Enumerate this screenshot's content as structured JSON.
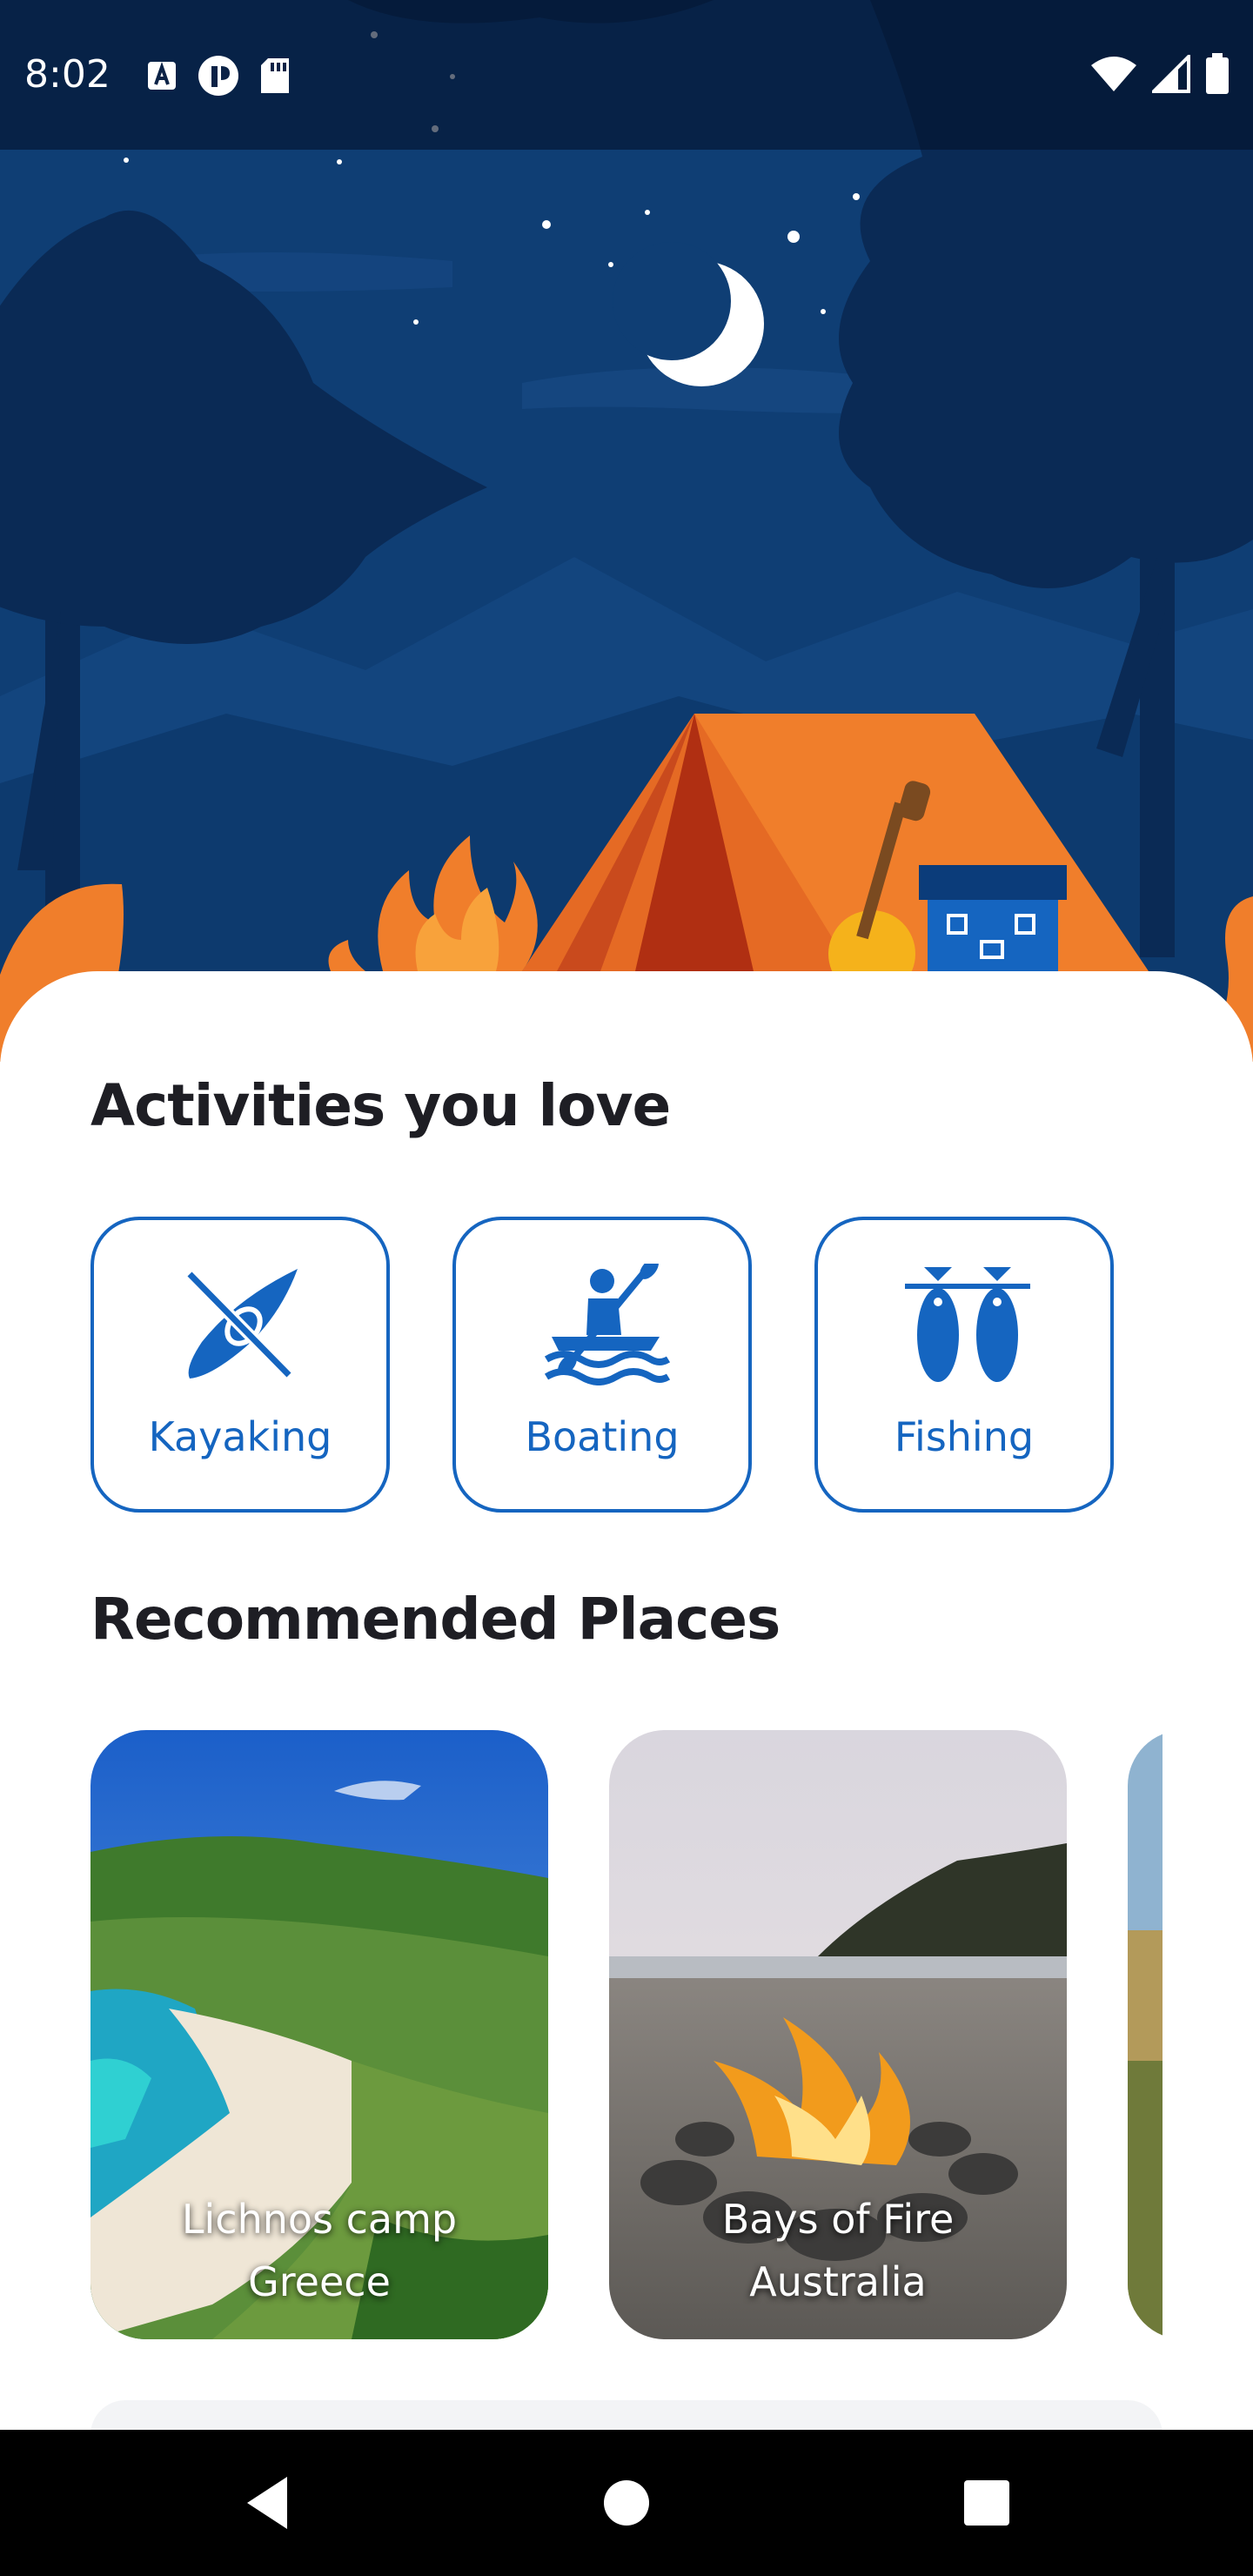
{
  "status_bar": {
    "time": "8:02",
    "left_icons": [
      "text-recognition-icon",
      "notification-app-icon",
      "sd-card-icon"
    ],
    "right_icons": [
      "wifi-icon",
      "cellular-signal-icon",
      "battery-icon"
    ]
  },
  "hero": {
    "illustration": "night-camping-scene",
    "elements": [
      "moon-icon",
      "stars",
      "trees",
      "campfire-icon",
      "tent-icon",
      "guitar-icon",
      "backpack-icon"
    ]
  },
  "activities": {
    "title": "Activities you love",
    "items": [
      {
        "label": "Kayaking",
        "icon": "kayak-icon"
      },
      {
        "label": "Boating",
        "icon": "paddle-boat-icon"
      },
      {
        "label": "Fishing",
        "icon": "fish-icon"
      }
    ]
  },
  "places": {
    "title": "Recommended Places",
    "items": [
      {
        "name": "Lichnos camp",
        "country": "Greece"
      },
      {
        "name": "Bays of Fire",
        "country": "Australia"
      }
    ]
  },
  "navigation": {
    "buttons": [
      "back-icon",
      "home-icon",
      "recents-icon"
    ]
  },
  "colors": {
    "accent": "#1565c0",
    "night_sky": "#0f3e74",
    "tent": "#f07e2b",
    "title_text": "#1e1e24"
  }
}
